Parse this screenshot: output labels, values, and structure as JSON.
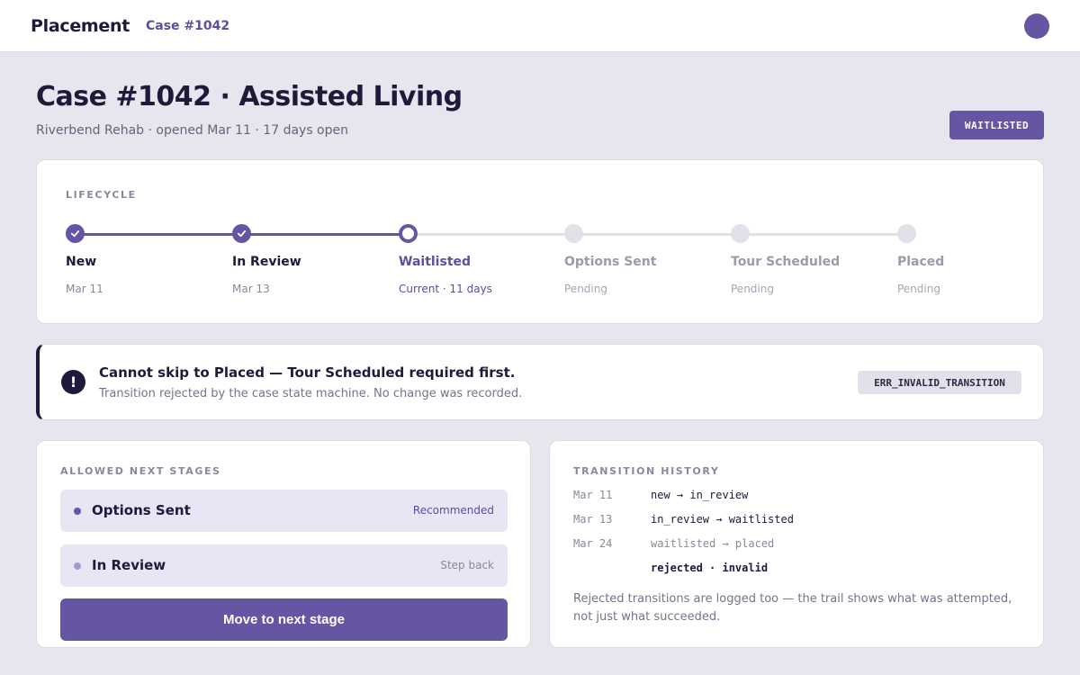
{
  "app": {
    "title": "Placement",
    "breadcrumb": "Case #1042"
  },
  "header": {
    "title": "Case #1042 · Assisted Living",
    "subtitle": "Riverbend Rehab · opened Mar 11 · 17 days open",
    "status_badge": "WAITLISTED"
  },
  "lifecycle": {
    "label": "LIFECYCLE",
    "steps": [
      {
        "name": "New",
        "meta": "Mar 11",
        "state": "done"
      },
      {
        "name": "In Review",
        "meta": "Mar 13",
        "state": "done"
      },
      {
        "name": "Waitlisted",
        "meta": "Current · 11 days",
        "state": "current"
      },
      {
        "name": "Options Sent",
        "meta": "Pending",
        "state": "pending"
      },
      {
        "name": "Tour Scheduled",
        "meta": "Pending",
        "state": "pending"
      },
      {
        "name": "Placed",
        "meta": "Pending",
        "state": "pending"
      }
    ]
  },
  "alert": {
    "icon": "!",
    "title": "Cannot skip to Placed — Tour Scheduled required first.",
    "body": "Transition rejected by the case state machine. No change was recorded.",
    "code": "ERR_INVALID_TRANSITION"
  },
  "next_stages": {
    "label": "ALLOWED NEXT STAGES",
    "options": [
      {
        "label": "Options Sent",
        "hint": "Recommended"
      },
      {
        "label": "In Review",
        "hint": "Step back"
      }
    ],
    "button": "Move to next stage"
  },
  "history": {
    "label": "TRANSITION HISTORY",
    "rows": [
      {
        "date": "Mar 11",
        "text": "new → in_review"
      },
      {
        "date": "Mar 13",
        "text": "in_review → waitlisted"
      },
      {
        "date": "Mar 24",
        "text": "waitlisted → placed"
      },
      {
        "date": "",
        "text": "rejected · invalid"
      }
    ],
    "note": "Rejected transitions are logged too — the trail shows what was attempted, not just what succeeded."
  },
  "colors": {
    "accent": "#6655a3",
    "pending": "#e1e1ea",
    "ink": "#1e1b3a",
    "muted": "#8a889a"
  }
}
